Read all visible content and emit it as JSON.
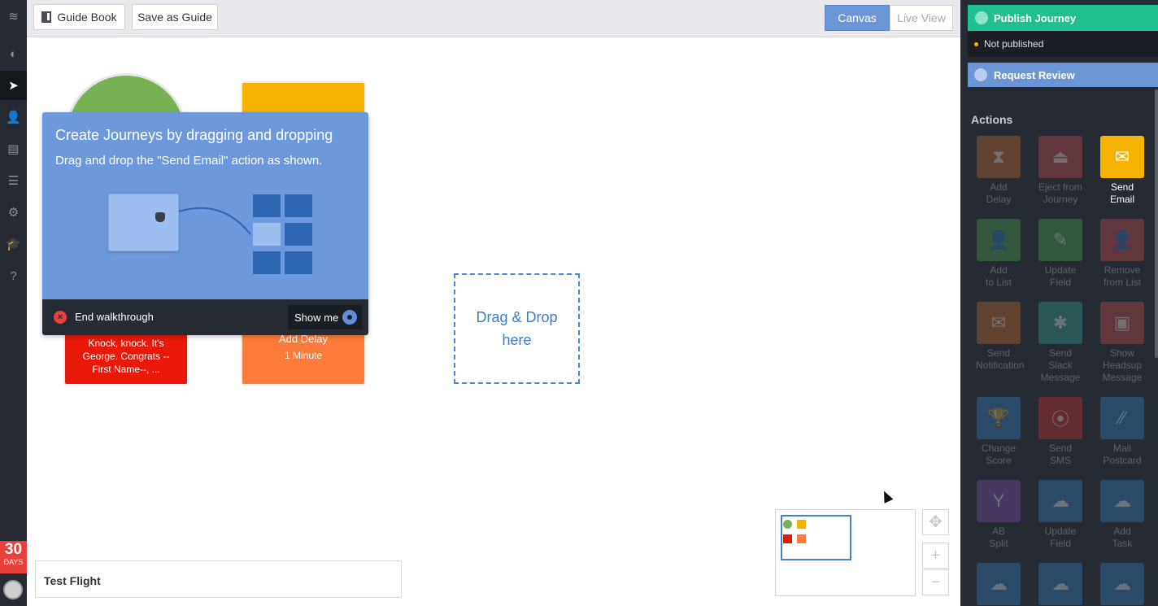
{
  "toolbar": {
    "guide_book": "Guide Book",
    "save_as_guide": "Save as Guide",
    "canvas": "Canvas",
    "live_view": "Live View"
  },
  "trial": {
    "days": "30",
    "label": "DAYS"
  },
  "nodes": {
    "red_text": "Knock, knock. It's George. Congrats --First Name--, ...",
    "orange_title": "Add Delay",
    "orange_sub": "1 Minute"
  },
  "dropzone": {
    "line1": "Drag & Drop",
    "line2": "here"
  },
  "walkthrough": {
    "title": "Create Journeys by dragging and dropping",
    "subtitle": "Drag and drop the \"Send Email\" action as shown.",
    "end_label": "End walkthrough",
    "show_me": "Show me"
  },
  "test_flight": "Test Flight",
  "zoom": {
    "move": "✥",
    "plus": "+",
    "minus": "−"
  },
  "right_panel": {
    "publish": "Publish Journey",
    "status": "Not published",
    "review": "Request Review",
    "actions_heading": "Actions",
    "actions": [
      {
        "l1": "Add",
        "l2": "Delay",
        "l3": "",
        "color": "#c0692e",
        "glyph": "⧗"
      },
      {
        "l1": "Eject from",
        "l2": "Journey",
        "l3": "",
        "color": "#c24a4f",
        "glyph": "⏏"
      },
      {
        "l1": "Send",
        "l2": "Email",
        "l3": "",
        "color": "#f6b200",
        "glyph": "✉"
      },
      {
        "l1": "Add",
        "l2": "to List",
        "l3": "",
        "color": "#4ea04f",
        "glyph": "👤"
      },
      {
        "l1": "Update",
        "l2": "Field",
        "l3": "",
        "color": "#4ea04f",
        "glyph": "✎"
      },
      {
        "l1": "Remove",
        "l2": "from List",
        "l3": "",
        "color": "#c24a4f",
        "glyph": "👤"
      },
      {
        "l1": "Send",
        "l2": "Notification",
        "l3": "",
        "color": "#c0692e",
        "glyph": "✉"
      },
      {
        "l1": "Send",
        "l2": "Slack",
        "l3": "Message",
        "color": "#2f9f90",
        "glyph": "✱"
      },
      {
        "l1": "Show",
        "l2": "Headsup",
        "l3": "Message",
        "color": "#c24a4f",
        "glyph": "▣"
      },
      {
        "l1": "Change",
        "l2": "Score",
        "l3": "",
        "color": "#2f7fc1",
        "glyph": "🏆"
      },
      {
        "l1": "Send",
        "l2": "SMS",
        "l3": "",
        "color": "#c9302c",
        "glyph": "⦿"
      },
      {
        "l1": "Mail",
        "l2": "Postcard",
        "l3": "",
        "color": "#2f7fc1",
        "glyph": "⁄⁄"
      },
      {
        "l1": "AB",
        "l2": "Split",
        "l3": "",
        "color": "#7e4db0",
        "glyph": "Y"
      },
      {
        "l1": "Update",
        "l2": "Field",
        "l3": "",
        "color": "#2f7fc1",
        "glyph": "☁"
      },
      {
        "l1": "Add",
        "l2": "Task",
        "l3": "",
        "color": "#2f7fc1",
        "glyph": "☁"
      },
      {
        "l1": "",
        "l2": "",
        "l3": "",
        "color": "#2f7fc1",
        "glyph": "☁"
      },
      {
        "l1": "",
        "l2": "",
        "l3": "",
        "color": "#2f7fc1",
        "glyph": "☁"
      },
      {
        "l1": "",
        "l2": "",
        "l3": "",
        "color": "#2f7fc1",
        "glyph": "☁"
      }
    ]
  },
  "nav_icons": [
    {
      "name": "logo-icon",
      "glyph": "≋"
    },
    {
      "name": "dashboard-icon",
      "glyph": "◐"
    },
    {
      "name": "journeys-icon",
      "glyph": "➤"
    },
    {
      "name": "people-icon",
      "glyph": "👤"
    },
    {
      "name": "reports-icon",
      "glyph": "▤"
    },
    {
      "name": "content-icon",
      "glyph": "☰"
    },
    {
      "name": "settings-icon",
      "glyph": "⚙"
    },
    {
      "name": "academy-icon",
      "glyph": "🎓"
    },
    {
      "name": "help-icon",
      "glyph": "?"
    }
  ]
}
